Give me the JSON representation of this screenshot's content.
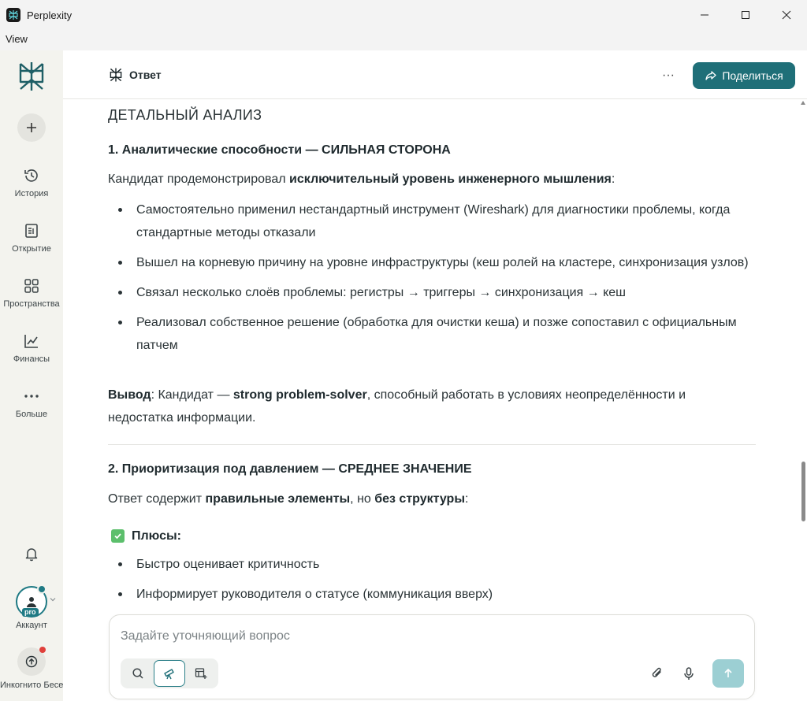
{
  "window": {
    "title": "Perplexity",
    "menu": [
      "View"
    ]
  },
  "sidebar": {
    "new_label": "+",
    "items": [
      {
        "label": "История",
        "icon": "history-icon"
      },
      {
        "label": "Открытие",
        "icon": "discover-icon"
      },
      {
        "label": "Пространства",
        "icon": "spaces-icon"
      },
      {
        "label": "Финансы",
        "icon": "finance-icon"
      },
      {
        "label": "Больше",
        "icon": "more-icon"
      }
    ],
    "account": {
      "label": "Аккаунт",
      "badge": "pro"
    },
    "incognito": {
      "label": "Инкогнито Беседа"
    }
  },
  "header": {
    "tab_label": "Ответ",
    "more_label": "···",
    "share_label": "Поделиться"
  },
  "content": {
    "title": "ДЕТАЛЬНЫЙ АНАЛИЗ",
    "section1": {
      "heading": "1. Аналитические способности — СИЛЬНАЯ СТОРОНА",
      "intro_pre": "Кандидат продемонстрировал ",
      "intro_bold": "исключительный уровень инженерного мышления",
      "intro_post": ":",
      "bullets": [
        "Самостоятельно применил нестандартный инструмент (Wireshark) для диагностики проблемы, когда стандартные методы отказали",
        "Вышел на корневую причину на уровне инфраструктуры (кеш ролей на кластере, синхронизация узлов)",
        "Связал несколько слоёв проблемы: регистры → триггеры → синхронизация → кеш",
        "Реализовал собственное решение (обработка для очистки кеша) и позже сопоставил с официальным патчем"
      ],
      "conclusion_label": "Вывод",
      "conclusion_pre": ": Кандидат — ",
      "conclusion_bold": "strong problem-solver",
      "conclusion_post": ", способный работать в условиях неопределённости и недостатка информации."
    },
    "section2": {
      "heading": "2. Приоритизация под давлением — СРЕДНЕЕ ЗНАЧЕНИЕ",
      "intro_pre": "Ответ содержит ",
      "intro_bold1": "правильные элементы",
      "intro_mid": ", но ",
      "intro_bold2": "без структуры",
      "intro_post": ":",
      "pros_label": "Плюсы:",
      "bullets": [
        "Быстро оценивает критичность",
        "Информирует руководителя о статусе (коммуникация вверх)"
      ]
    }
  },
  "composer": {
    "placeholder": "Задайте уточняющий вопрос"
  },
  "colors": {
    "accent": "#1f6f78",
    "send_disabled": "#9ccfd3",
    "sidebar_bg": "#f3f3ee"
  }
}
